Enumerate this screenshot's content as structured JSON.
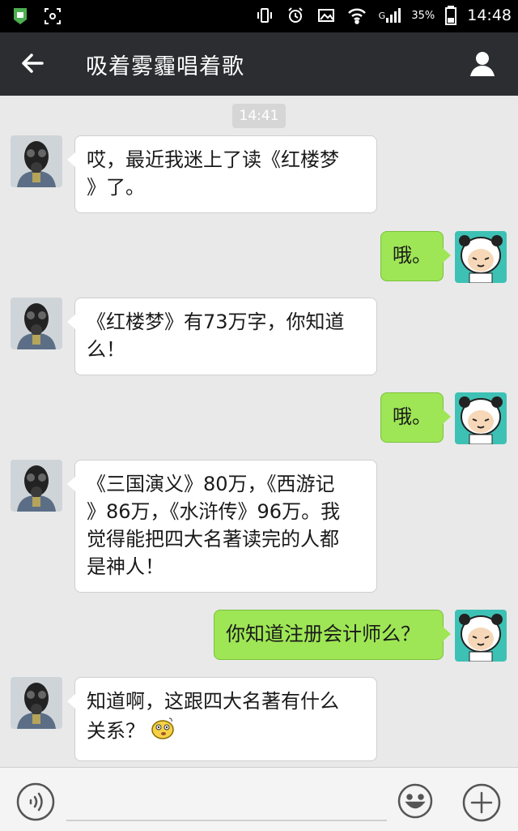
{
  "status_bar": {
    "battery_percent": "35%",
    "time": "14:48",
    "network": "G"
  },
  "header": {
    "title": "吸着雾霾唱着歌"
  },
  "chat": {
    "timestamp": "14:41",
    "messages": [
      {
        "side": "in",
        "text": "哎，最近我迷上了读《红楼梦\n》了。"
      },
      {
        "side": "out",
        "text": "哦。"
      },
      {
        "side": "in",
        "text": "《红楼梦》有73万字，你知道\n么！"
      },
      {
        "side": "out",
        "text": "哦。"
      },
      {
        "side": "in",
        "text": "《三国演义》80万，《西游记\n》86万，《水浒传》96万。我\n觉得能把四大名著读完的人都\n是神人！"
      },
      {
        "side": "out",
        "text": "你知道注册会计师么？"
      },
      {
        "side": "in",
        "text": "知道啊，这跟四大名著有什么\n关系？"
      }
    ]
  },
  "colors": {
    "outgoing_bubble": "#9ee655",
    "incoming_bubble": "#ffffff",
    "title_bar": "#2b2d31",
    "chat_bg": "#e9e9e9"
  }
}
